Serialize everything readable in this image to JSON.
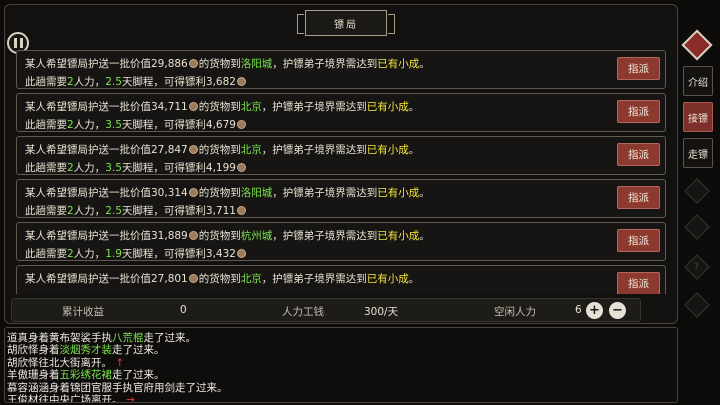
{
  "title": "镖局",
  "sidebar": {
    "tabs": [
      "介绍",
      "接镖",
      "走镖"
    ],
    "active_tab": "接镖",
    "locked_icons": [
      "",
      "",
      "?",
      ""
    ]
  },
  "missions": [
    {
      "prefix": "某人希望镖局护送一批价值",
      "value": "29,886",
      "mid": "的货物到",
      "city": "洛阳城",
      "suffix": "，护镖弟子境界需达到",
      "rank": "已有小成",
      "end": "。",
      "l2a": "此趟需要",
      "people": "2",
      "l2b": "人力，",
      "days": "2.5",
      "l2c": "天脚程，可得镖利",
      "reward": "3,682",
      "button": "指派"
    },
    {
      "prefix": "某人希望镖局护送一批价值",
      "value": "34,711",
      "mid": "的货物到",
      "city": "北京",
      "suffix": "，护镖弟子境界需达到",
      "rank": "已有小成",
      "end": "。",
      "l2a": "此趟需要",
      "people": "2",
      "l2b": "人力，",
      "days": "3.5",
      "l2c": "天脚程，可得镖利",
      "reward": "4,679",
      "button": "指派"
    },
    {
      "prefix": "某人希望镖局护送一批价值",
      "value": "27,847",
      "mid": "的货物到",
      "city": "北京",
      "suffix": "，护镖弟子境界需达到",
      "rank": "已有小成",
      "end": "。",
      "l2a": "此趟需要",
      "people": "2",
      "l2b": "人力，",
      "days": "3.5",
      "l2c": "天脚程，可得镖利",
      "reward": "4,199",
      "button": "指派"
    },
    {
      "prefix": "某人希望镖局护送一批价值",
      "value": "30,314",
      "mid": "的货物到",
      "city": "洛阳城",
      "suffix": "，护镖弟子境界需达到",
      "rank": "已有小成",
      "end": "。",
      "l2a": "此趟需要",
      "people": "2",
      "l2b": "人力，",
      "days": "2.5",
      "l2c": "天脚程，可得镖利",
      "reward": "3,711",
      "button": "指派"
    },
    {
      "prefix": "某人希望镖局护送一批价值",
      "value": "31,889",
      "mid": "的货物到",
      "city": "杭州城",
      "suffix": "，护镖弟子境界需达到",
      "rank": "已有小成",
      "end": "。",
      "l2a": "此趟需要",
      "people": "2",
      "l2b": "人力，",
      "days": "1.9",
      "l2c": "天脚程，可得镖利",
      "reward": "3,432",
      "button": "指派"
    },
    {
      "prefix": "某人希望镖局护送一批价值",
      "value": "27,801",
      "mid": "的货物到",
      "city": "北京",
      "suffix": "，护镖弟子境界需达到",
      "rank": "已有小成",
      "end": "。",
      "l2a": "",
      "people": "",
      "l2b": "",
      "days": "",
      "l2c": "",
      "reward": "",
      "button": "指派"
    }
  ],
  "stats": {
    "income_label": "累计收益",
    "income_value": "0",
    "labor_label": "人力工钱",
    "labor_value": "300/天",
    "idle_label": "空闲人力",
    "idle_value": "6",
    "plus": "+",
    "minus": "−"
  },
  "log": [
    {
      "a": "道真身着黄布袈裟手执",
      "item": "八荒棍",
      "b": "走了过来。",
      "arrow": ""
    },
    {
      "a": "胡欣怿身着",
      "item": "淡烟秀才装",
      "b": "走了过来。",
      "arrow": ""
    },
    {
      "a": "胡欣怿往北大街离开。",
      "item": "",
      "b": "",
      "arrow": "↑"
    },
    {
      "a": "羊傲珊身着",
      "item": "五彩绣花裙",
      "b": "走了过来。",
      "arrow": ""
    },
    {
      "a": "慕容涵涵身着锦团官服手执官府用剑走了过来。",
      "item": "",
      "b": "",
      "arrow": ""
    },
    {
      "a": "王俊材往中央广场离开。",
      "item": "",
      "b": "",
      "arrow": "→"
    }
  ]
}
